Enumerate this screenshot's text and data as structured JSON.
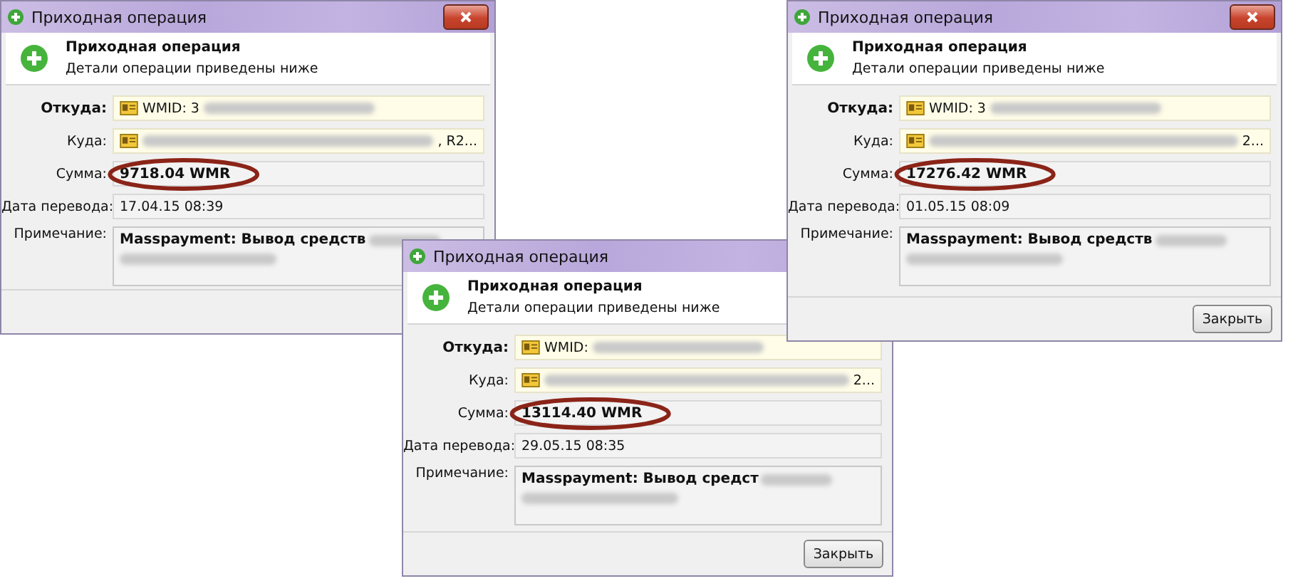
{
  "windows": [
    {
      "title": "Приходная операция",
      "heading": "Приходная операция",
      "subheading": "Детали операции приведены ниже",
      "fields": [
        {
          "kind": "sender",
          "label": "Откуда:",
          "text": "WMID: 3"
        },
        {
          "kind": "recipient",
          "label": "Куда:",
          "text": ", R2..."
        },
        {
          "kind": "amount",
          "label": "Сумма:",
          "text": "9718.04 WMR",
          "circled": true
        },
        {
          "kind": "date",
          "label": "Дата перевода:",
          "text": "17.04.15 08:39"
        },
        {
          "kind": "note",
          "label": "Примечание:",
          "text": "Masspayment: Вывод средств"
        }
      ]
    },
    {
      "title": "Приходная операция",
      "heading": "Приходная операция",
      "subheading": "Детали операции приведены ниже",
      "fields": [
        {
          "kind": "sender",
          "label": "Откуда:",
          "text": "WMID:"
        },
        {
          "kind": "recipient",
          "label": "Куда:",
          "text": "2..."
        },
        {
          "kind": "amount",
          "label": "Сумма:",
          "text": "13114.40 WMR",
          "circled": true
        },
        {
          "kind": "date",
          "label": "Дата перевода:",
          "text": "29.05.15 08:35"
        },
        {
          "kind": "note",
          "label": "Примечание:",
          "text": "Masspayment: Вывод средст"
        }
      ],
      "button": "Закрыть"
    },
    {
      "title": "Приходная операция",
      "heading": "Приходная операция",
      "subheading": "Детали операции приведены ниже",
      "fields": [
        {
          "kind": "sender",
          "label": "Откуда:",
          "text": "WMID: 3"
        },
        {
          "kind": "recipient",
          "label": "Куда:",
          "text": "2..."
        },
        {
          "kind": "amount",
          "label": "Сумма:",
          "text": "17276.42 WMR",
          "circled": true
        },
        {
          "kind": "date",
          "label": "Дата перевода:",
          "text": "01.05.15 08:09"
        },
        {
          "kind": "note",
          "label": "Примечание:",
          "text": "Masspayment: Вывод средств"
        }
      ],
      "button": "Закрыть"
    }
  ]
}
